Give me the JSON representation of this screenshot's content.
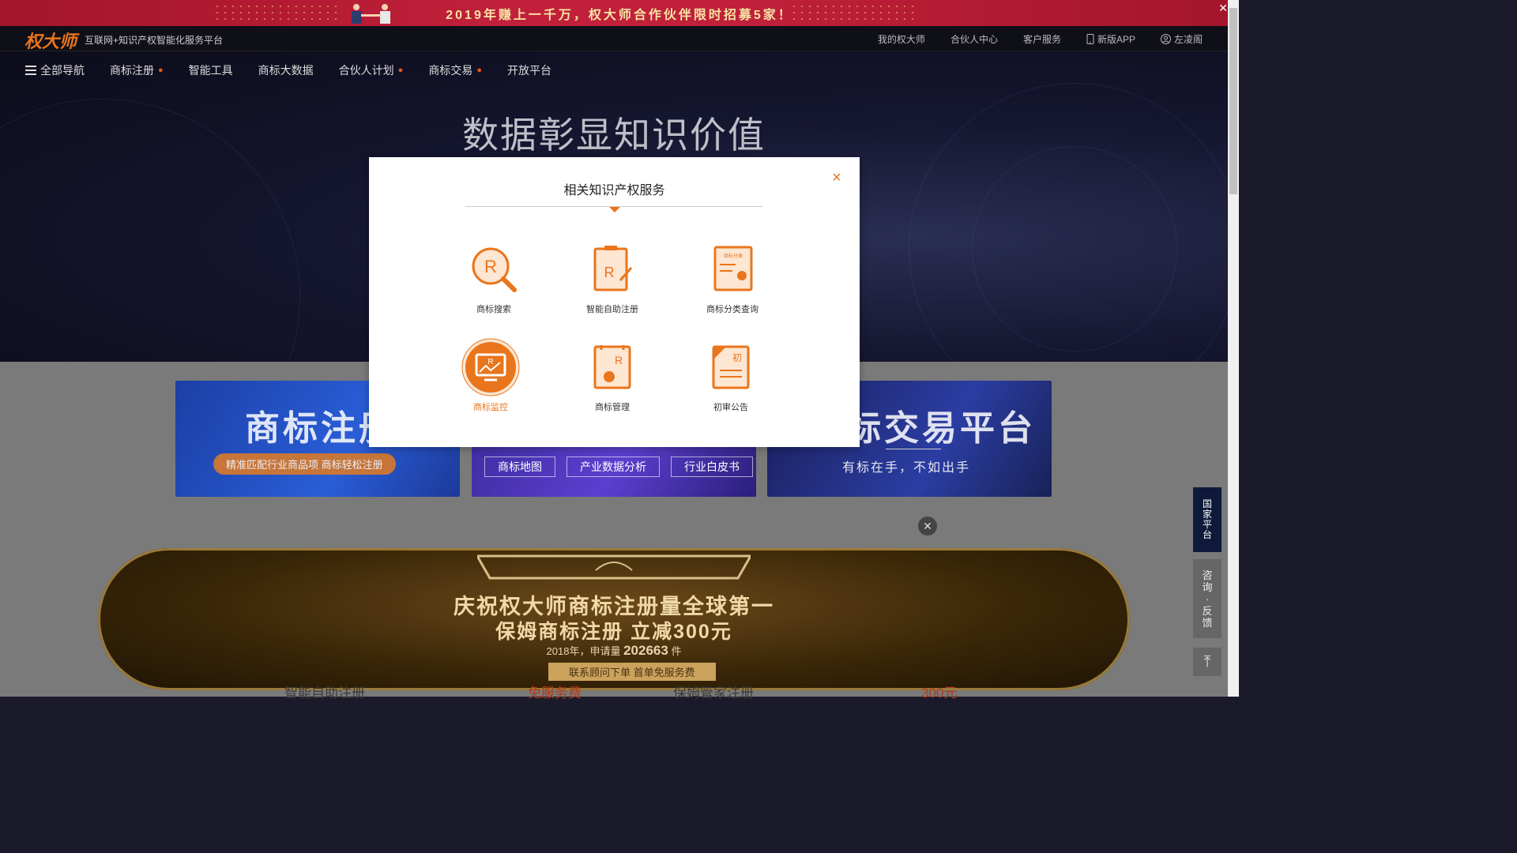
{
  "top_banner": {
    "text": "2019年赚上一千万，权大师合作伙伴限时招募5家！",
    "close": "✕"
  },
  "header": {
    "logo": "权大师",
    "slogan": "互联网+知识产权智能化服务平台",
    "links": {
      "my": "我的权大师",
      "partner": "合伙人中心",
      "service": "客户服务",
      "app": "新版APP",
      "user": "左凌阁"
    }
  },
  "nav": {
    "all": "全部导航",
    "items": [
      "商标注册",
      "智能工具",
      "商标大数据",
      "合伙人计划",
      "商标交易",
      "开放平台"
    ]
  },
  "hero": {
    "title": "数据彰显知识价值"
  },
  "cards": {
    "reg": {
      "big": "商标注册",
      "pill": "精准匹配行业商品项 商标轻松注册"
    },
    "data": {
      "tags": [
        "商标地图",
        "产业数据分析",
        "行业白皮书"
      ]
    },
    "trade": {
      "big": "标交易平台",
      "sub": "有标在手，不如出手"
    }
  },
  "ad": {
    "line1": "庆祝权大师商标注册量全球第一",
    "line2": "保姆商标注册 立减300元",
    "line3_prefix": "2018年，申请量",
    "line3_num": "202663",
    "line3_suffix": "件",
    "line4": "联系顾问下单 首单免服务费"
  },
  "bottom_peek": {
    "a": "智能自助注册",
    "b": "免服务费",
    "c": "保姆管家注册",
    "d": "300元"
  },
  "side": {
    "nation": [
      "国",
      "家",
      "平",
      "台"
    ],
    "consult": [
      "咨",
      "询",
      "·",
      "反",
      "馈"
    ],
    "top": "⤒"
  },
  "modal": {
    "title": "相关知识产权服务",
    "close": "×",
    "services": [
      {
        "label": "商标搜索",
        "icon": "trademark-search-icon"
      },
      {
        "label": "智能自助注册",
        "icon": "smart-register-icon"
      },
      {
        "label": "商标分类查询",
        "icon": "class-query-icon"
      },
      {
        "label": "商标监控",
        "icon": "trademark-monitor-icon",
        "active": true
      },
      {
        "label": "商标管理",
        "icon": "trademark-manage-icon"
      },
      {
        "label": "初审公告",
        "icon": "initial-announcement-icon"
      }
    ],
    "icon_text": {
      "r": "R",
      "class_tag": "商标分类",
      "chu": "初"
    }
  },
  "colors": {
    "accent": "#e9751c",
    "banner": "#c0203a"
  }
}
